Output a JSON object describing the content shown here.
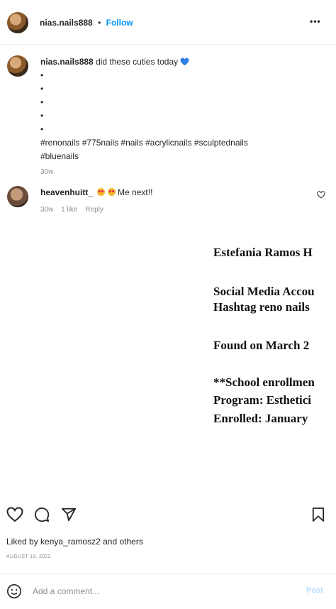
{
  "post": {
    "author": "nias.nails888",
    "follow_label": "Follow",
    "more_label": "•••",
    "separator": "•",
    "caption_author": "nias.nails888",
    "caption_text": "did these cuties today",
    "bullets": [
      "•",
      "•",
      "•",
      "•",
      "•"
    ],
    "hashtags_line1": "#renonails #775nails #nails #acrylicnails #sculptednails",
    "hashtags_line2": "#bluenails",
    "caption_age": "30w"
  },
  "comment": {
    "author": "heavenhuitt_",
    "text": "Me next!!",
    "age": "30w",
    "likes": "1 like",
    "reply_label": "Reply"
  },
  "document": {
    "line1": "Estefania Ramos H",
    "line2": "Social Media Accou",
    "line3": "Hashtag reno nails",
    "line4": "Found on March 2",
    "line5": "**School enrollmen",
    "line6": "Program: Esthetici",
    "line7": "Enrolled: January"
  },
  "footer": {
    "liked_by_prefix": "Liked by",
    "liked_by_user": "kenya_ramosz2",
    "liked_by_suffix": "and others",
    "date": "AUGUST 18, 2022",
    "comment_placeholder": "Add a comment...",
    "post_label": "Post"
  },
  "icons": [
    "more-icon",
    "heart-icon",
    "comment-icon",
    "share-icon",
    "bookmark-icon",
    "emoji-icon",
    "heart-eyes-emoji-icon",
    "blue-heart-emoji-icon"
  ]
}
